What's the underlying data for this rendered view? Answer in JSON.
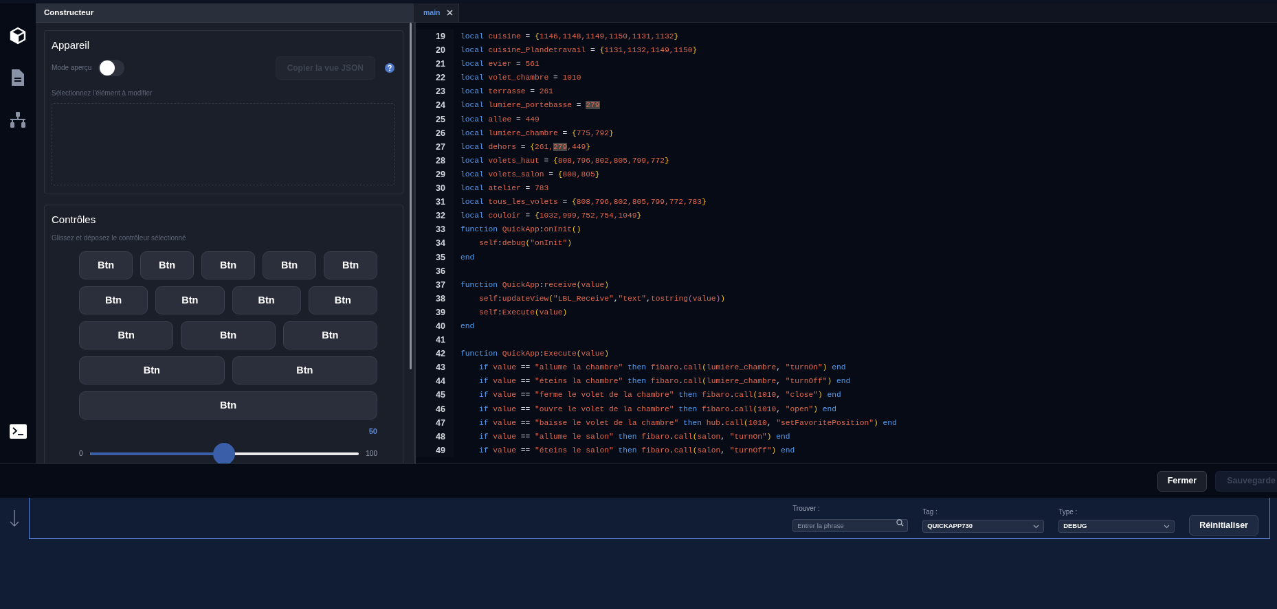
{
  "sidebar": {
    "items": [
      {
        "kind": "cube",
        "selected": true
      },
      {
        "kind": "document",
        "selected": false
      },
      {
        "kind": "network",
        "selected": false
      }
    ],
    "bottom_items": [
      {
        "kind": "terminal"
      }
    ]
  },
  "builder": {
    "title": "Constructeur",
    "device": {
      "title": "Appareil",
      "preview_mode": {
        "label": "Mode aperçu",
        "on": false
      },
      "copy_button": {
        "label": "Copier la vue JSON",
        "disabled": true
      },
      "hint": "Sélectionnez l'élément à modifier"
    },
    "controls": {
      "title": "Contrôles",
      "hint": "Glissez et déposez le contrôleur sélectionné",
      "button_rows": [
        [
          "Btn",
          "Btn",
          "Btn",
          "Btn",
          "Btn"
        ],
        [
          "Btn",
          "Btn",
          "Btn",
          "Btn"
        ],
        [
          "Btn",
          "Btn",
          "Btn"
        ],
        [
          "Btn",
          "Btn"
        ],
        [
          "Btn"
        ]
      ],
      "slider": {
        "value": "50",
        "min": "0",
        "max": "100",
        "level": 0.5
      }
    }
  },
  "editor": {
    "tabs": [
      {
        "label": "main",
        "selected": true
      }
    ],
    "lines": [
      {
        "number": "19",
        "tokens": [
          {
            "kind": "kw",
            "text": "local"
          },
          {
            "kind": "id",
            "text": " cuisine "
          },
          {
            "kind": "p",
            "text": "= "
          },
          {
            "kind": "b",
            "text": "{"
          },
          {
            "kind": "id",
            "text": "1146,1148,1149,1150,1131,1132"
          },
          {
            "kind": "b",
            "text": "}"
          }
        ]
      },
      {
        "number": "20",
        "tokens": [
          {
            "kind": "kw",
            "text": "local"
          },
          {
            "kind": "id",
            "text": " cuisine_Plandetravail "
          },
          {
            "kind": "p",
            "text": "= "
          },
          {
            "kind": "b",
            "text": "{"
          },
          {
            "kind": "id",
            "text": "1131,1132,1149,1150"
          },
          {
            "kind": "b",
            "text": "}"
          }
        ]
      },
      {
        "number": "21",
        "tokens": [
          {
            "kind": "kw",
            "text": "local"
          },
          {
            "kind": "id",
            "text": " evier "
          },
          {
            "kind": "p",
            "text": "= "
          },
          {
            "kind": "id",
            "text": "561"
          }
        ]
      },
      {
        "number": "22",
        "tokens": [
          {
            "kind": "kw",
            "text": "local"
          },
          {
            "kind": "id",
            "text": " volet_chambre "
          },
          {
            "kind": "p",
            "text": "= "
          },
          {
            "kind": "id",
            "text": "1010"
          }
        ]
      },
      {
        "number": "23",
        "tokens": [
          {
            "kind": "kw",
            "text": "local"
          },
          {
            "kind": "id",
            "text": " terrasse "
          },
          {
            "kind": "p",
            "text": "= "
          },
          {
            "kind": "id",
            "text": "261"
          }
        ]
      },
      {
        "number": "24",
        "tokens": [
          {
            "kind": "kw",
            "text": "local"
          },
          {
            "kind": "id",
            "text": " lumiere_portebasse "
          },
          {
            "kind": "p",
            "text": "= "
          },
          {
            "kind": "match",
            "text": "279"
          }
        ]
      },
      {
        "number": "25",
        "tokens": [
          {
            "kind": "kw",
            "text": "local"
          },
          {
            "kind": "id",
            "text": " allee "
          },
          {
            "kind": "p",
            "text": "= "
          },
          {
            "kind": "id",
            "text": "449"
          }
        ]
      },
      {
        "number": "26",
        "tokens": [
          {
            "kind": "kw",
            "text": "local"
          },
          {
            "kind": "id",
            "text": " lumiere_chambre "
          },
          {
            "kind": "p",
            "text": "= "
          },
          {
            "kind": "b",
            "text": "{"
          },
          {
            "kind": "id",
            "text": "775,792"
          },
          {
            "kind": "b",
            "text": "}"
          }
        ]
      },
      {
        "number": "27",
        "tokens": [
          {
            "kind": "kw",
            "text": "local"
          },
          {
            "kind": "id",
            "text": " dehors "
          },
          {
            "kind": "p",
            "text": "= "
          },
          {
            "kind": "b",
            "text": "{"
          },
          {
            "kind": "id",
            "text": "261,"
          },
          {
            "kind": "match",
            "text": "279"
          },
          {
            "kind": "id",
            "text": ",449"
          },
          {
            "kind": "b",
            "text": "}"
          }
        ]
      },
      {
        "number": "28",
        "tokens": [
          {
            "kind": "kw",
            "text": "local"
          },
          {
            "kind": "id",
            "text": " volets_haut "
          },
          {
            "kind": "p",
            "text": "= "
          },
          {
            "kind": "b",
            "text": "{"
          },
          {
            "kind": "id",
            "text": "808,796,802,805,799,772"
          },
          {
            "kind": "b",
            "text": "}"
          }
        ]
      },
      {
        "number": "29",
        "tokens": [
          {
            "kind": "kw",
            "text": "local"
          },
          {
            "kind": "id",
            "text": " volets_salon "
          },
          {
            "kind": "p",
            "text": "= "
          },
          {
            "kind": "b",
            "text": "{"
          },
          {
            "kind": "id",
            "text": "808,805"
          },
          {
            "kind": "b",
            "text": "}"
          }
        ]
      },
      {
        "number": "30",
        "tokens": [
          {
            "kind": "kw",
            "text": "local"
          },
          {
            "kind": "id",
            "text": " atelier "
          },
          {
            "kind": "p",
            "text": "= "
          },
          {
            "kind": "id",
            "text": "783"
          }
        ]
      },
      {
        "number": "31",
        "tokens": [
          {
            "kind": "kw",
            "text": "local"
          },
          {
            "kind": "id",
            "text": " tous_les_volets "
          },
          {
            "kind": "p",
            "text": "= "
          },
          {
            "kind": "b",
            "text": "{"
          },
          {
            "kind": "id",
            "text": "808,796,802,805,799,772,783"
          },
          {
            "kind": "b",
            "text": "}"
          }
        ]
      },
      {
        "number": "32",
        "tokens": [
          {
            "kind": "kw",
            "text": "local"
          },
          {
            "kind": "id",
            "text": " couloir "
          },
          {
            "kind": "p",
            "text": "= "
          },
          {
            "kind": "b",
            "text": "{"
          },
          {
            "kind": "id",
            "text": "1032,999,752,754,1049"
          },
          {
            "kind": "b",
            "text": "}"
          }
        ]
      },
      {
        "number": "33",
        "tokens": [
          {
            "kind": "kw",
            "text": "function"
          },
          {
            "kind": "id",
            "text": " QuickApp"
          },
          {
            "kind": "p",
            "text": ":"
          },
          {
            "kind": "id",
            "text": "onInit"
          },
          {
            "kind": "b",
            "text": "()"
          }
        ]
      },
      {
        "number": "34",
        "tokens": [
          {
            "kind": "id",
            "text": "    self"
          },
          {
            "kind": "p",
            "text": ":"
          },
          {
            "kind": "id",
            "text": "debug"
          },
          {
            "kind": "b",
            "text": "("
          },
          {
            "kind": "id",
            "text": "\"onInit\""
          },
          {
            "kind": "b",
            "text": ")"
          }
        ]
      },
      {
        "number": "35",
        "tokens": [
          {
            "kind": "kw",
            "text": "end"
          }
        ]
      },
      {
        "number": "36"
      },
      {
        "number": "37",
        "tokens": [
          {
            "kind": "kw",
            "text": "function"
          },
          {
            "kind": "id",
            "text": " QuickApp"
          },
          {
            "kind": "p",
            "text": ":"
          },
          {
            "kind": "id",
            "text": "receive"
          },
          {
            "kind": "b",
            "text": "("
          },
          {
            "kind": "id",
            "text": "value"
          },
          {
            "kind": "b",
            "text": ")"
          }
        ]
      },
      {
        "number": "38",
        "tokens": [
          {
            "kind": "id",
            "text": "    self"
          },
          {
            "kind": "p",
            "text": ":"
          },
          {
            "kind": "id",
            "text": "updateView"
          },
          {
            "kind": "b",
            "text": "("
          },
          {
            "kind": "id",
            "text": "\"LBL_Receive\""
          },
          {
            "kind": "p",
            "text": ","
          },
          {
            "kind": "id",
            "text": "\"text\""
          },
          {
            "kind": "p",
            "text": ","
          },
          {
            "kind": "id",
            "text": "tostring"
          },
          {
            "kind": "pr",
            "text": "("
          },
          {
            "kind": "id",
            "text": "value"
          },
          {
            "kind": "pr",
            "text": ")"
          },
          {
            "kind": "b",
            "text": ")"
          }
        ]
      },
      {
        "number": "39",
        "tokens": [
          {
            "kind": "id",
            "text": "    self"
          },
          {
            "kind": "p",
            "text": ":"
          },
          {
            "kind": "id",
            "text": "Execute"
          },
          {
            "kind": "b",
            "text": "("
          },
          {
            "kind": "id",
            "text": "value"
          },
          {
            "kind": "b",
            "text": ")"
          }
        ]
      },
      {
        "number": "40",
        "tokens": [
          {
            "kind": "kw",
            "text": "end"
          }
        ]
      },
      {
        "number": "41"
      },
      {
        "number": "42",
        "tokens": [
          {
            "kind": "kw",
            "text": "function"
          },
          {
            "kind": "id",
            "text": " QuickApp"
          },
          {
            "kind": "p",
            "text": ":"
          },
          {
            "kind": "id",
            "text": "Execute"
          },
          {
            "kind": "b",
            "text": "("
          },
          {
            "kind": "id",
            "text": "value"
          },
          {
            "kind": "b",
            "text": ")"
          }
        ]
      },
      {
        "number": "43",
        "tokens": [
          {
            "kind": "kw",
            "text": "    if"
          },
          {
            "kind": "id",
            "text": " value "
          },
          {
            "kind": "p",
            "text": "== "
          },
          {
            "kind": "id",
            "text": "\"allume la chambre\" "
          },
          {
            "kind": "kw",
            "text": "then"
          },
          {
            "kind": "id",
            "text": " fibaro"
          },
          {
            "kind": "p",
            "text": "."
          },
          {
            "kind": "id",
            "text": "call"
          },
          {
            "kind": "b",
            "text": "("
          },
          {
            "kind": "id",
            "text": "lumiere_chambre"
          },
          {
            "kind": "p",
            "text": ", "
          },
          {
            "kind": "id",
            "text": "\"turnOn\""
          },
          {
            "kind": "b",
            "text": ")"
          },
          {
            "kind": "kw",
            "text": " end"
          }
        ]
      },
      {
        "number": "44",
        "tokens": [
          {
            "kind": "kw",
            "text": "    if"
          },
          {
            "kind": "id",
            "text": " value "
          },
          {
            "kind": "p",
            "text": "== "
          },
          {
            "kind": "id",
            "text": "\"éteins la chambre\" "
          },
          {
            "kind": "kw",
            "text": "then"
          },
          {
            "kind": "id",
            "text": " fibaro"
          },
          {
            "kind": "p",
            "text": "."
          },
          {
            "kind": "id",
            "text": "call"
          },
          {
            "kind": "b",
            "text": "("
          },
          {
            "kind": "id",
            "text": "lumiere_chambre"
          },
          {
            "kind": "p",
            "text": ", "
          },
          {
            "kind": "id",
            "text": "\"turnOff\""
          },
          {
            "kind": "b",
            "text": ")"
          },
          {
            "kind": "kw",
            "text": " end"
          }
        ]
      },
      {
        "number": "45",
        "tokens": [
          {
            "kind": "kw",
            "text": "    if"
          },
          {
            "kind": "id",
            "text": " value "
          },
          {
            "kind": "p",
            "text": "== "
          },
          {
            "kind": "id",
            "text": "\"ferme le volet de la chambre\" "
          },
          {
            "kind": "kw",
            "text": "then"
          },
          {
            "kind": "id",
            "text": " fibaro"
          },
          {
            "kind": "p",
            "text": "."
          },
          {
            "kind": "id",
            "text": "call"
          },
          {
            "kind": "b",
            "text": "("
          },
          {
            "kind": "id",
            "text": "1010"
          },
          {
            "kind": "p",
            "text": ", "
          },
          {
            "kind": "id",
            "text": "\"close\""
          },
          {
            "kind": "b",
            "text": ")"
          },
          {
            "kind": "kw",
            "text": " end"
          }
        ]
      },
      {
        "number": "46",
        "tokens": [
          {
            "kind": "kw",
            "text": "    if"
          },
          {
            "kind": "id",
            "text": " value "
          },
          {
            "kind": "p",
            "text": "== "
          },
          {
            "kind": "id",
            "text": "\"ouvre le volet de la chambre\" "
          },
          {
            "kind": "kw",
            "text": "then"
          },
          {
            "kind": "id",
            "text": " fibaro"
          },
          {
            "kind": "p",
            "text": "."
          },
          {
            "kind": "id",
            "text": "call"
          },
          {
            "kind": "b",
            "text": "("
          },
          {
            "kind": "id",
            "text": "1010"
          },
          {
            "kind": "p",
            "text": ", "
          },
          {
            "kind": "id",
            "text": "\"open\""
          },
          {
            "kind": "b",
            "text": ")"
          },
          {
            "kind": "kw",
            "text": " end"
          }
        ]
      },
      {
        "number": "47",
        "tokens": [
          {
            "kind": "kw",
            "text": "    if"
          },
          {
            "kind": "id",
            "text": " value "
          },
          {
            "kind": "p",
            "text": "== "
          },
          {
            "kind": "id",
            "text": "\"baisse le volet de la chambre\" "
          },
          {
            "kind": "kw",
            "text": "then"
          },
          {
            "kind": "id",
            "text": " hub"
          },
          {
            "kind": "p",
            "text": "."
          },
          {
            "kind": "id",
            "text": "call"
          },
          {
            "kind": "b",
            "text": "("
          },
          {
            "kind": "id",
            "text": "1010"
          },
          {
            "kind": "p",
            "text": ", "
          },
          {
            "kind": "id",
            "text": "\"setFavoritePosition\""
          },
          {
            "kind": "b",
            "text": ")"
          },
          {
            "kind": "kw",
            "text": " end"
          }
        ]
      },
      {
        "number": "48",
        "tokens": [
          {
            "kind": "kw",
            "text": "    if"
          },
          {
            "kind": "id",
            "text": " value "
          },
          {
            "kind": "p",
            "text": "== "
          },
          {
            "kind": "id",
            "text": "\"allume le salon\" "
          },
          {
            "kind": "kw",
            "text": "then"
          },
          {
            "kind": "id",
            "text": " fibaro"
          },
          {
            "kind": "p",
            "text": "."
          },
          {
            "kind": "id",
            "text": "call"
          },
          {
            "kind": "b",
            "text": "("
          },
          {
            "kind": "id",
            "text": "salon"
          },
          {
            "kind": "p",
            "text": ", "
          },
          {
            "kind": "id",
            "text": "\"turnOn\""
          },
          {
            "kind": "b",
            "text": ")"
          },
          {
            "kind": "kw",
            "text": " end"
          }
        ]
      },
      {
        "number": "49",
        "tokens": [
          {
            "kind": "kw",
            "text": "    if"
          },
          {
            "kind": "id",
            "text": " value "
          },
          {
            "kind": "p",
            "text": "== "
          },
          {
            "kind": "id",
            "text": "\"éteins le salon\" "
          },
          {
            "kind": "kw",
            "text": "then"
          },
          {
            "kind": "id",
            "text": " fibaro"
          },
          {
            "kind": "p",
            "text": "."
          },
          {
            "kind": "id",
            "text": "call"
          },
          {
            "kind": "b",
            "text": "("
          },
          {
            "kind": "id",
            "text": "salon"
          },
          {
            "kind": "p",
            "text": ", "
          },
          {
            "kind": "id",
            "text": "\"turnOff\""
          },
          {
            "kind": "b",
            "text": ")"
          },
          {
            "kind": "kw",
            "text": " end"
          }
        ]
      }
    ]
  },
  "footer_buttons": [
    {
      "label": "Fermer",
      "disabled": false
    },
    {
      "label": "Sauvegarde",
      "disabled": true
    }
  ],
  "console": {
    "find": {
      "label": "Trouver :",
      "placeholder": "Entrer la phrase"
    },
    "tag": {
      "label": "Tag :",
      "value": "QUICKAPP730"
    },
    "type": {
      "label": "Type :",
      "value": "DEBUG"
    },
    "reset_button": "Réinitialiser"
  }
}
